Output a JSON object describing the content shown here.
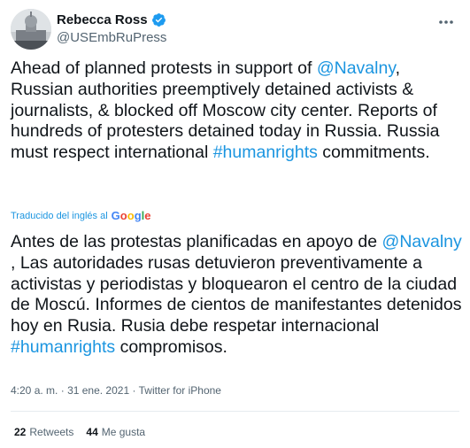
{
  "author": {
    "display_name": "Rebecca Ross",
    "handle": "@USEmbRuPress",
    "verified": true
  },
  "tweet": {
    "segments": [
      {
        "text": "Ahead of planned protests in support of ",
        "type": "text"
      },
      {
        "text": "@Navalny",
        "type": "mention"
      },
      {
        "text": ", Russian authorities preemptively detained activists & journalists, & blocked off Moscow city center. Reports of hundreds of protesters detained today in Russia. Russia must respect international ",
        "type": "text"
      },
      {
        "text": "#humanrights",
        "type": "hashtag"
      },
      {
        "text": " commitments.",
        "type": "text"
      }
    ]
  },
  "translation": {
    "label": "Traducido del inglés al",
    "provider": "Google",
    "segments": [
      {
        "text": "Antes de las protestas planificadas en apoyo de ",
        "type": "text"
      },
      {
        "text": "@Navalny",
        "type": "mention"
      },
      {
        "text": " , Las autoridades rusas detuvieron preventivamente a activistas y periodistas y bloquearon el centro de la ciudad de Moscú. Informes de cientos de manifestantes detenidos hoy en Rusia. Rusia debe respetar internacional ",
        "type": "text"
      },
      {
        "text": "#humanrights",
        "type": "hashtag"
      },
      {
        "text": " compromisos.",
        "type": "text"
      }
    ]
  },
  "meta": {
    "time": "4:20 a. m.",
    "separator": "·",
    "date": "31 ene. 2021",
    "source": "Twitter for iPhone"
  },
  "stats": {
    "retweets_count": "22",
    "retweets_label": "Retweets",
    "likes_count": "44",
    "likes_label": "Me gusta"
  },
  "colors": {
    "link": "#1b95e0",
    "verified": "#1d9bf0",
    "secondary_text": "#536471"
  },
  "icons": {
    "more": "more-dots-icon",
    "verified": "verified-badge-icon"
  }
}
